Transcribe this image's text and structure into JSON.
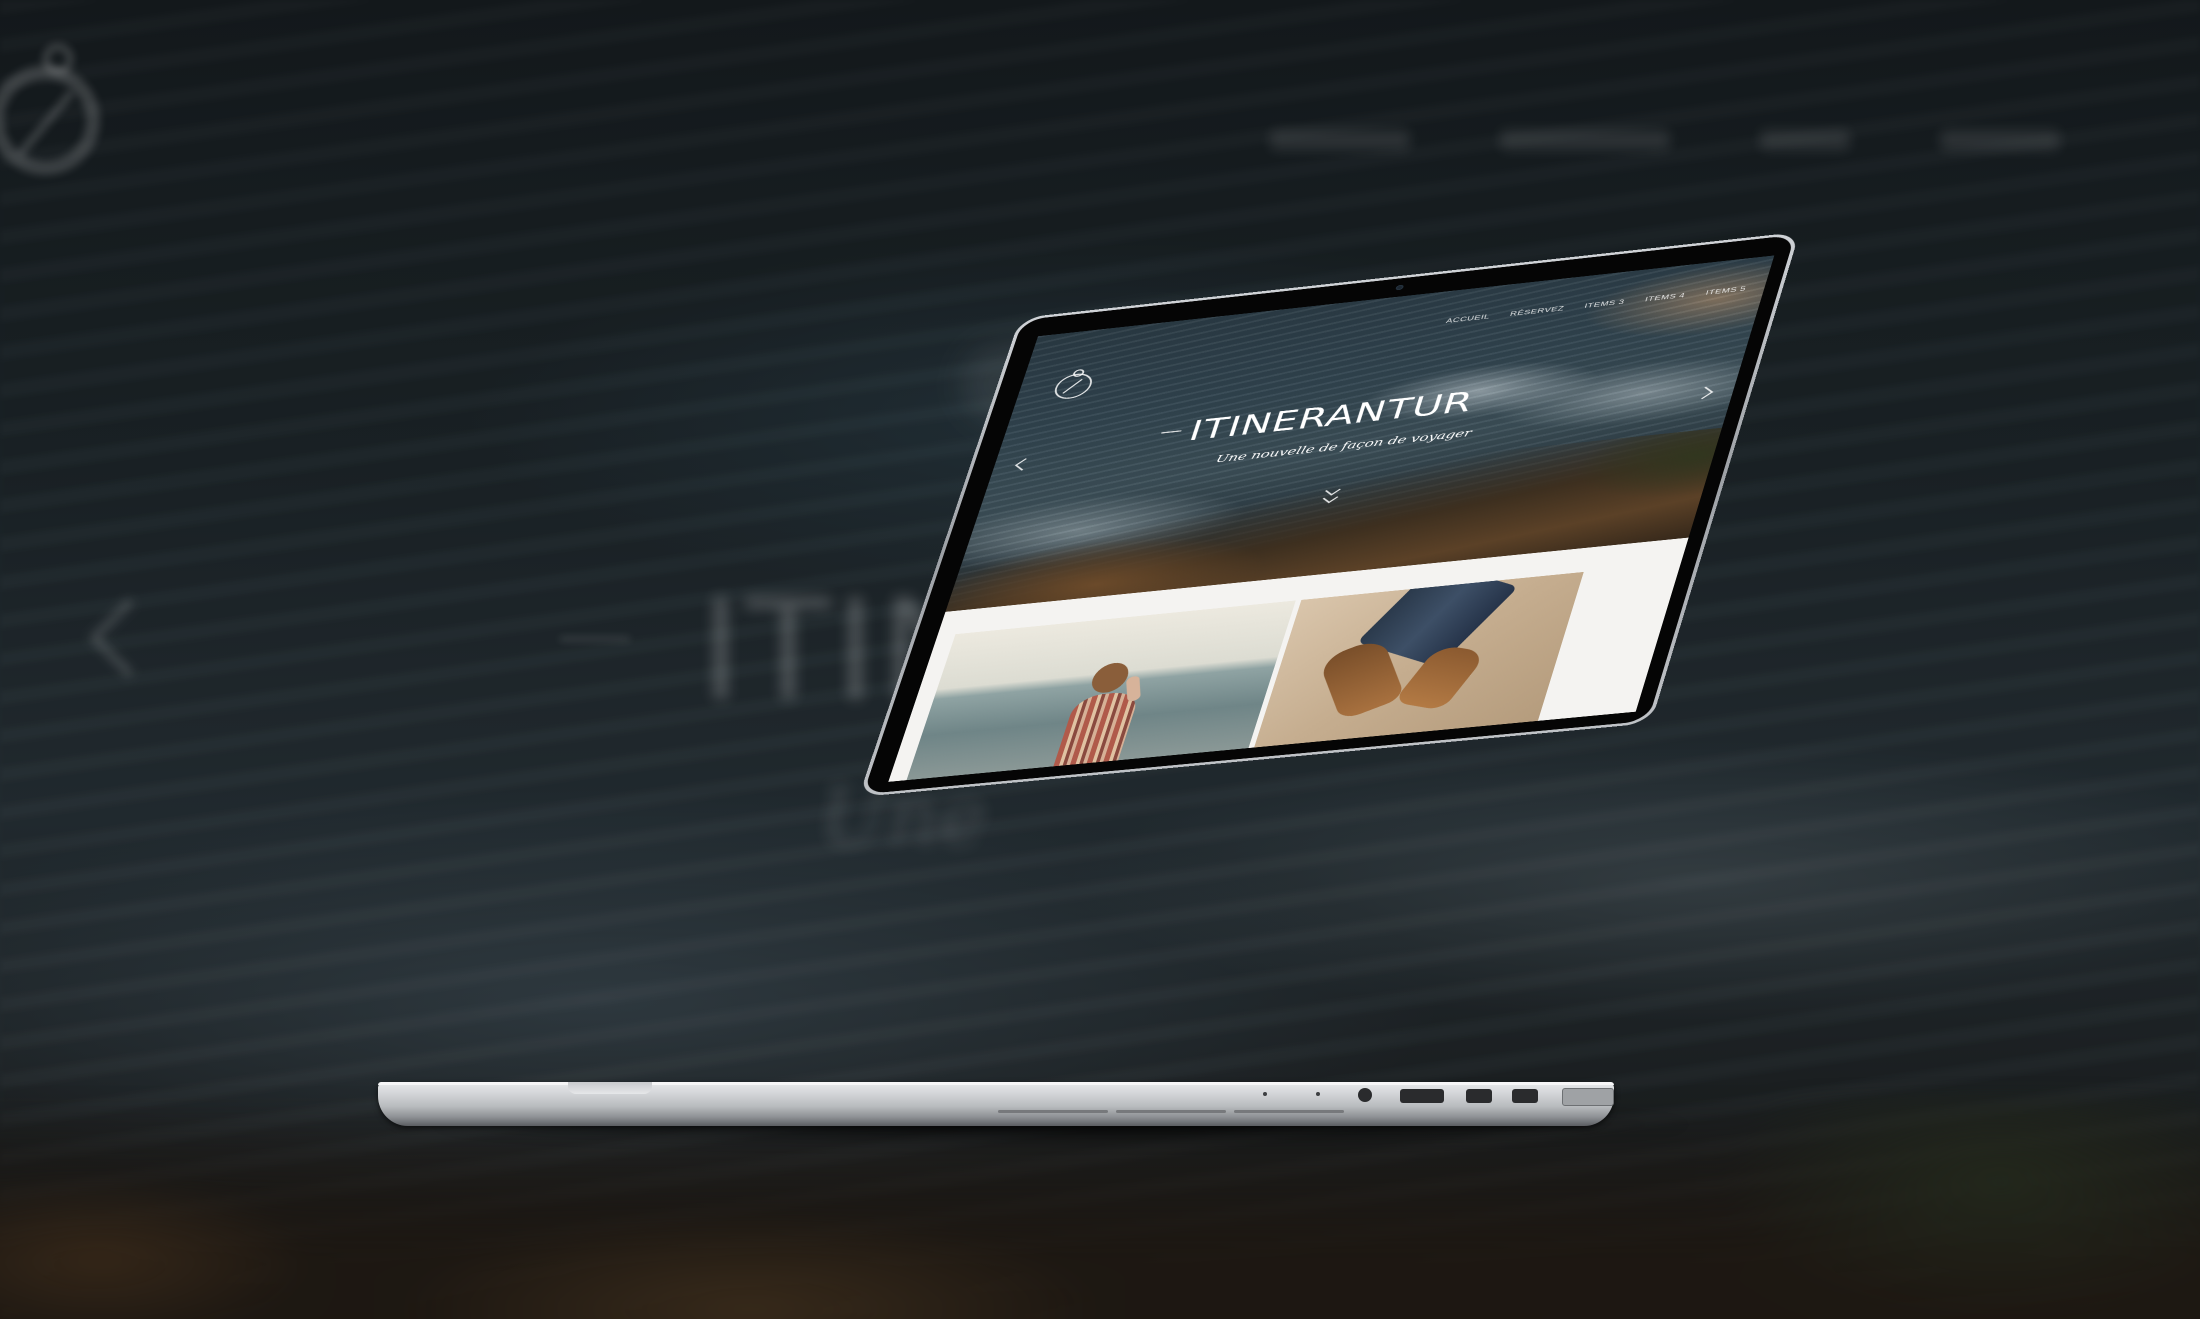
{
  "site": {
    "title": "ITINERANTUR",
    "subtitle": "Une nouvelle de façon de voyager",
    "nav": [
      "ACCUEIL",
      "RÉSERVEZ",
      "ITEMS 3",
      "ITEMS 4",
      "ITEMS 5"
    ]
  },
  "background": {
    "title_fragment": "ITINER",
    "script_fragment": "Une"
  },
  "colors": {
    "page_background": "#0e1214",
    "hero_text": "#ffffff",
    "content_background": "#f4f3f1",
    "laptop_aluminum": "#c9cccf"
  },
  "icons": {
    "logo": "compass-icon",
    "prev": "chevron-left-icon",
    "next": "chevron-right-icon",
    "scroll": "double-chevron-down-icon"
  }
}
